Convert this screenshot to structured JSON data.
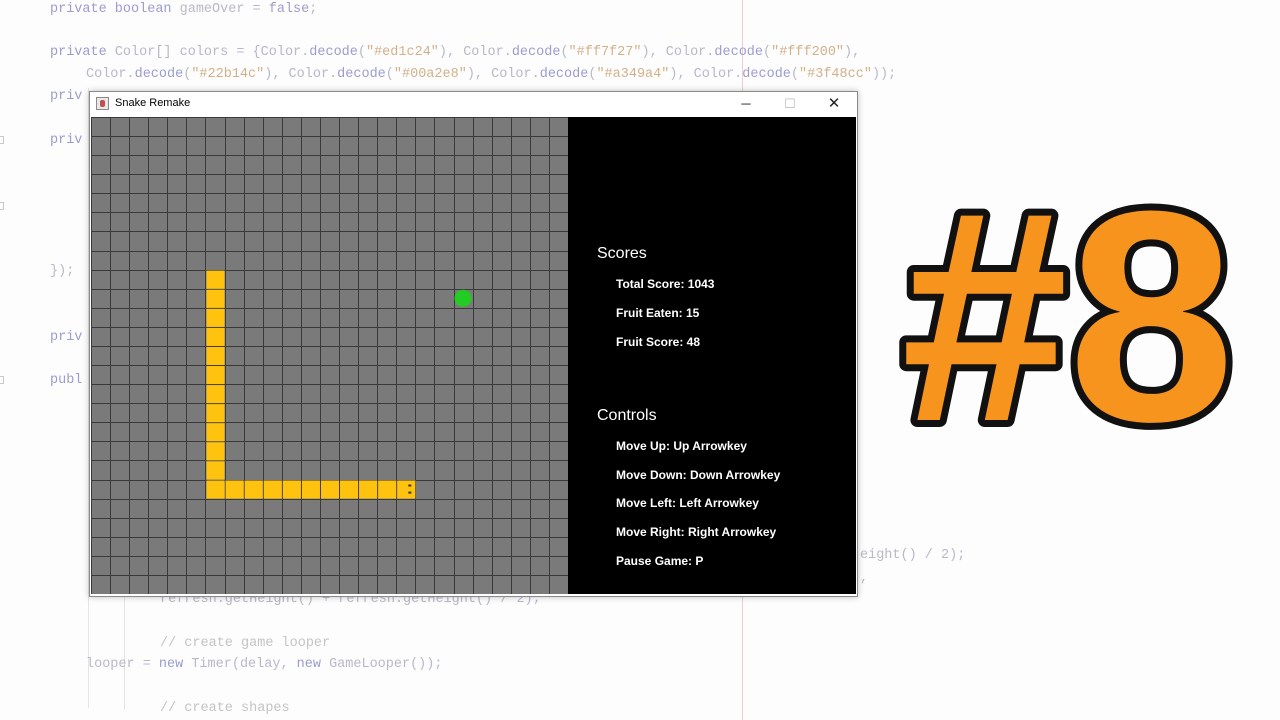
{
  "code_lines": [
    {
      "id": "code-line-1",
      "text": [
        [
          "kw",
          "private boolean"
        ],
        [
          "",
          " gameOver = "
        ],
        [
          "kw",
          "false"
        ],
        [
          "",
          ";"
        ]
      ]
    },
    {
      "id": "code-line-2",
      "text": [
        [
          "kw",
          "private"
        ],
        [
          "",
          " Color[] colors = {Color."
        ],
        [
          "kw",
          "decode"
        ],
        [
          "",
          "("
        ],
        [
          "str",
          "\"#ed1c24\""
        ],
        [
          "",
          "), Color."
        ],
        [
          "kw",
          "decode"
        ],
        [
          "",
          "("
        ],
        [
          "str",
          "\"#ff7f27\""
        ],
        [
          "",
          "), Color."
        ],
        [
          "kw",
          "decode"
        ],
        [
          "",
          "("
        ],
        [
          "str",
          "\"#fff200\""
        ],
        [
          "",
          "),"
        ]
      ]
    },
    {
      "id": "code-line-3",
      "text": [
        [
          "",
          "Color."
        ],
        [
          "kw",
          "decode"
        ],
        [
          "",
          "("
        ],
        [
          "str",
          "\"#22b14c\""
        ],
        [
          "",
          "), Color."
        ],
        [
          "kw",
          "decode"
        ],
        [
          "",
          "("
        ],
        [
          "str",
          "\"#00a2e8\""
        ],
        [
          "",
          "), Color."
        ],
        [
          "kw",
          "decode"
        ],
        [
          "",
          "("
        ],
        [
          "str",
          "\"#a349a4\""
        ],
        [
          "",
          "), Color."
        ],
        [
          "kw",
          "decode"
        ],
        [
          "",
          "("
        ],
        [
          "str",
          "\"#3f48cc\""
        ],
        [
          "",
          "));"
        ]
      ]
    },
    {
      "id": "code-line-4",
      "text": [
        [
          "kw",
          "priv"
        ]
      ]
    },
    {
      "id": "code-line-5",
      "text": [
        [
          "kw",
          "priv"
        ]
      ]
    },
    {
      "id": "code-line-6",
      "text": [
        [
          "",
          "});"
        ]
      ]
    },
    {
      "id": "code-line-7",
      "text": [
        [
          "kw",
          "priv"
        ]
      ]
    },
    {
      "id": "code-line-8",
      "text": [
        [
          "kw",
          "publ"
        ]
      ]
    },
    {
      "id": "code-line-9",
      "text": [
        [
          "",
          "eight() / 2);"
        ]
      ]
    },
    {
      "id": "code-line-10",
      "text": [
        [
          "",
          ","
        ]
      ]
    },
    {
      "id": "code-line-11",
      "text": [
        [
          "",
          "refresh.getHeight() + refresh.getHeight() / 2);"
        ]
      ]
    },
    {
      "id": "code-line-12",
      "text": [
        [
          "cm",
          "// create game looper"
        ]
      ]
    },
    {
      "id": "code-line-13",
      "text": [
        [
          "",
          "looper = "
        ],
        [
          "kw",
          "new"
        ],
        [
          "",
          " Timer(delay, "
        ],
        [
          "kw",
          "new"
        ],
        [
          "",
          " GameLooper());"
        ]
      ]
    },
    {
      "id": "code-line-14",
      "text": [
        [
          "cm",
          "// create shapes"
        ]
      ]
    }
  ],
  "window": {
    "title": "Snake Remake",
    "minimize_glyph": "─",
    "maximize_glyph": "☐",
    "close_glyph": "✕"
  },
  "game": {
    "grid_columns": 25,
    "grid_rows": 25,
    "board_color": "#7a7a7a",
    "grid_line_color": "#3a3a3a",
    "snake_color": "#ffc20e",
    "fruit_color": "#22cc22",
    "snake_cells": [
      [
        6,
        8
      ],
      [
        6,
        9
      ],
      [
        6,
        10
      ],
      [
        6,
        11
      ],
      [
        6,
        12
      ],
      [
        6,
        13
      ],
      [
        6,
        14
      ],
      [
        6,
        15
      ],
      [
        6,
        16
      ],
      [
        6,
        17
      ],
      [
        6,
        18
      ],
      [
        6,
        19
      ],
      [
        7,
        19
      ],
      [
        8,
        19
      ],
      [
        9,
        19
      ],
      [
        10,
        19
      ],
      [
        11,
        19
      ],
      [
        12,
        19
      ],
      [
        13,
        19
      ],
      [
        14,
        19
      ],
      [
        15,
        19
      ],
      [
        16,
        19
      ]
    ],
    "snake_head": [
      16,
      19
    ],
    "fruit_cell": [
      19,
      9
    ]
  },
  "panel": {
    "scores_title": "Scores",
    "scores": [
      {
        "id": "total-score",
        "text": "Total Score: 1043"
      },
      {
        "id": "fruit-eaten",
        "text": "Fruit Eaten: 15"
      },
      {
        "id": "fruit-score",
        "text": "Fruit Score: 48"
      }
    ],
    "controls_title": "Controls",
    "controls": [
      {
        "id": "control-up",
        "text": "Move Up: Up Arrowkey"
      },
      {
        "id": "control-down",
        "text": "Move Down: Down Arrowkey"
      },
      {
        "id": "control-left",
        "text": "Move Left: Left Arrowkey"
      },
      {
        "id": "control-right",
        "text": "Move Right: Right Arrowkey"
      },
      {
        "id": "control-pause",
        "text": "Pause Game: P"
      }
    ]
  },
  "badge": {
    "text": "#8",
    "fill": "#f7941d",
    "stroke": "#111111"
  }
}
